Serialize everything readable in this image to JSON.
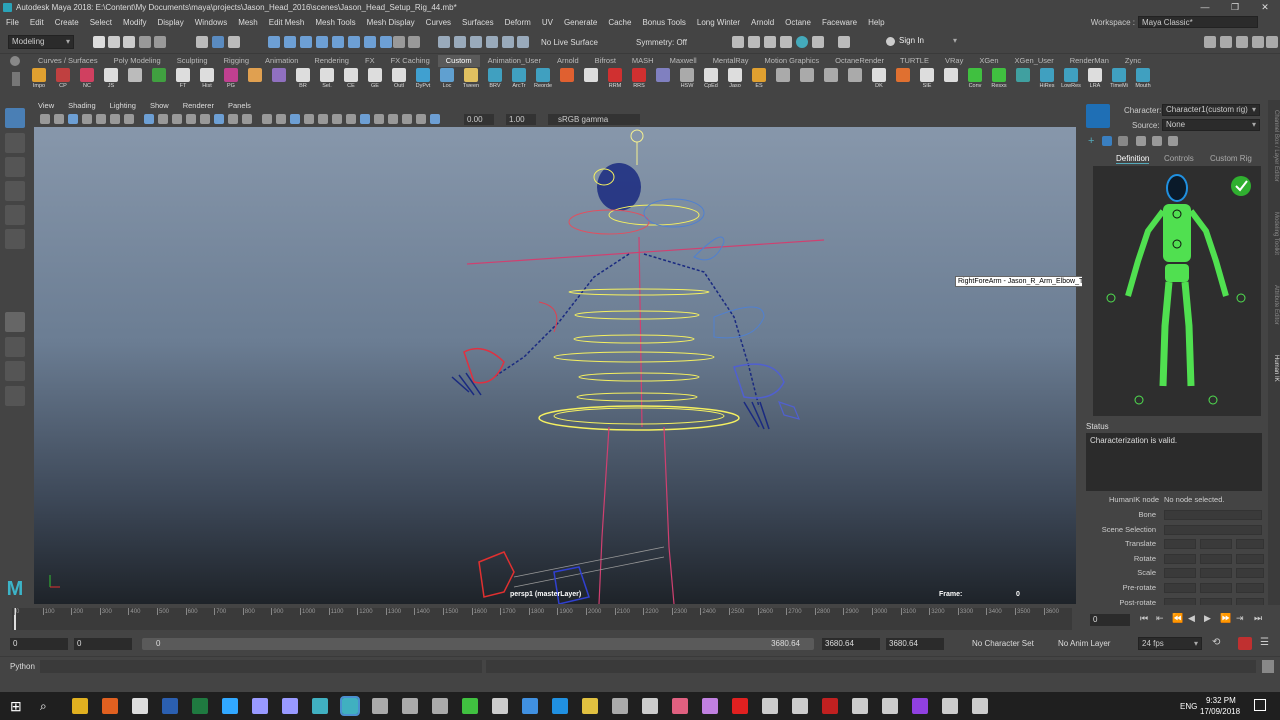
{
  "window": {
    "title": "Autodesk Maya 2018: E:\\Content\\My Documents\\maya\\projects\\Jason_Head_2016\\scenes\\Jason_Head_Setup_Rig_44.mb*"
  },
  "menu": [
    "File",
    "Edit",
    "Create",
    "Select",
    "Modify",
    "Display",
    "Windows",
    "Mesh",
    "Edit Mesh",
    "Mesh Tools",
    "Mesh Display",
    "Curves",
    "Surfaces",
    "Deform",
    "UV",
    "Generate",
    "Cache",
    "Bonus Tools",
    "Long Winter",
    "Arnold",
    "Octane",
    "Faceware",
    "Help"
  ],
  "workspace": {
    "label": "Workspace :",
    "value": "Maya Classic*"
  },
  "statusline": {
    "mode": "Modeling",
    "live_surface": "No Live Surface",
    "symmetry": "Symmetry: Off",
    "sign_in": "Sign In"
  },
  "shelf_tabs": [
    "Curves / Surfaces",
    "Poly Modeling",
    "Sculpting",
    "Rigging",
    "Animation",
    "Rendering",
    "FX",
    "FX Caching",
    "Custom",
    "Animation_User",
    "Arnold",
    "Bifrost",
    "MASH",
    "Maxwell",
    "MentalRay",
    "Motion Graphics",
    "OctaneRender",
    "TURTLE",
    "VRay",
    "XGen",
    "XGen_User",
    "RenderMan",
    "Zync"
  ],
  "shelf_active": "Custom",
  "shelf_items": [
    {
      "label": "Impo",
      "icon": "import-icon",
      "color": "#e0a030"
    },
    {
      "label": "CP",
      "icon": "component-icon",
      "color": "#c04040"
    },
    {
      "label": "NC",
      "icon": "nurbs-circle-icon",
      "color": "#d04060"
    },
    {
      "label": "JS",
      "icon": "joint-icon",
      "color": "#dddddd"
    },
    {
      "label": "",
      "icon": "move-pivot-icon",
      "color": "#bbbbbb"
    },
    {
      "label": "",
      "icon": "grid-icon",
      "color": "#40a040"
    },
    {
      "label": "FT",
      "icon": "freeze-icon",
      "color": "#dddddd"
    },
    {
      "label": "Hist",
      "icon": "history-icon",
      "color": "#dddddd"
    },
    {
      "label": "PG",
      "icon": "paint-icon",
      "color": "#c04090"
    },
    {
      "label": "",
      "icon": "hand-icon",
      "color": "#e0a050"
    },
    {
      "label": "",
      "icon": "paint-weights-icon",
      "color": "#9070c0"
    },
    {
      "label": "BR",
      "icon": "brush-icon",
      "color": "#dddddd"
    },
    {
      "label": "Sel.",
      "icon": "select-icon",
      "color": "#dddddd"
    },
    {
      "label": "CE",
      "icon": "curve-editor-icon",
      "color": "#dddddd"
    },
    {
      "label": "GE",
      "icon": "graph-editor-icon",
      "color": "#dddddd"
    },
    {
      "label": "Outl",
      "icon": "outliner-icon",
      "color": "#dddddd"
    },
    {
      "label": "DyPvt",
      "icon": "pivot-icon",
      "color": "#40a0d0"
    },
    {
      "label": "Loc",
      "icon": "locator-icon",
      "color": "#60a0d0"
    },
    {
      "label": "Tween",
      "icon": "tween-icon",
      "color": "#e0c060"
    },
    {
      "label": "BRV",
      "icon": "brv-icon",
      "color": "#40a0c0"
    },
    {
      "label": "ArcTr",
      "icon": "arc-tracker-icon",
      "color": "#40a0c0"
    },
    {
      "label": "Reorde",
      "icon": "reorder-icon",
      "color": "#40a0c0"
    },
    {
      "label": "",
      "icon": "diamond-icon",
      "color": "#e06030"
    },
    {
      "label": "",
      "icon": "sphere-icon",
      "color": "#dddddd"
    },
    {
      "label": "RRM",
      "icon": "rrm-icon",
      "color": "#d03030"
    },
    {
      "label": "RRS",
      "icon": "rrs-icon",
      "color": "#d03030"
    },
    {
      "label": "",
      "icon": "transfer-icon",
      "color": "#8080c0"
    },
    {
      "label": "HSW",
      "icon": "hsw-icon",
      "color": "#aaaaaa"
    },
    {
      "label": "CpEd",
      "icon": "cp-edit-icon",
      "color": "#dddddd"
    },
    {
      "label": "Jaso",
      "icon": "jason-icon",
      "color": "#dddddd"
    },
    {
      "label": "ES",
      "icon": "es-icon",
      "color": "#e0a030"
    },
    {
      "label": "",
      "icon": "eye-icon",
      "color": "#aaaaaa"
    },
    {
      "label": "",
      "icon": "ring-icon",
      "color": "#aaaaaa"
    },
    {
      "label": "",
      "icon": "cylinder-icon",
      "color": "#aaaaaa"
    },
    {
      "label": "",
      "icon": "cube-icon",
      "color": "#aaaaaa"
    },
    {
      "label": "DK",
      "icon": "dk-icon",
      "color": "#dddddd"
    },
    {
      "label": "",
      "icon": "octane-icon",
      "color": "#e07030"
    },
    {
      "label": "SIE",
      "icon": "sie-icon",
      "color": "#dddddd"
    },
    {
      "label": "",
      "icon": "s-icon",
      "color": "#dddddd"
    },
    {
      "label": "Conv",
      "icon": "convert-icon",
      "color": "#40c040"
    },
    {
      "label": "Resxs",
      "icon": "resxs-icon",
      "color": "#40c040"
    },
    {
      "label": "",
      "icon": "script-icon",
      "color": "#40a0a0"
    },
    {
      "label": "HiRes",
      "icon": "hires-icon",
      "color": "#40a0c0"
    },
    {
      "label": "LowRes",
      "icon": "lowres-icon",
      "color": "#40a0c0"
    },
    {
      "label": "LRA",
      "icon": "lra-icon",
      "color": "#dddddd"
    },
    {
      "label": "TimeMi",
      "icon": "time-icon",
      "color": "#40a0c0"
    },
    {
      "label": "Mouth",
      "icon": "mouth-icon",
      "color": "#40a0c0"
    }
  ],
  "viewport": {
    "menu": [
      "View",
      "Shading",
      "Lighting",
      "Show",
      "Renderer",
      "Panels"
    ],
    "exposure": "0.00",
    "gamma": "1.00",
    "color_space": "sRGB gamma",
    "camera_label": "persp1 (masterLayer)",
    "frame_label": "Frame:",
    "frame_value": "0",
    "tooltip": "RightForeArm - Jason_R_Arm_Elbow_TwistStartJnt"
  },
  "hik": {
    "character_label": "Character:",
    "character_value": "Character1(custom rig)",
    "source_label": "Source:",
    "source_value": "None",
    "tabs": [
      "Definition",
      "Controls",
      "Custom Rig"
    ],
    "active_tab": "Definition",
    "status_title": "Status",
    "status_text": "Characterization is valid.",
    "node_label": "HumanIK node",
    "node_value": "No node selected.",
    "props": [
      "Bone",
      "Scene Selection",
      "Translate",
      "Rotate",
      "Scale",
      "Pre-rotate",
      "Post-rotate"
    ]
  },
  "right_strip": [
    "Channel Box / Layer Editor",
    "Modeling Toolkit",
    "Attribute Editor",
    "Human IK"
  ],
  "timeline": {
    "ticks": [
      "0",
      "100",
      "200",
      "300",
      "400",
      "500",
      "600",
      "700",
      "800",
      "900",
      "1000",
      "1100",
      "1200",
      "1300",
      "1400",
      "1500",
      "1600",
      "1700",
      "1800",
      "1900",
      "2000",
      "2100",
      "2200",
      "2300",
      "2400",
      "2500",
      "2600",
      "2700",
      "2800",
      "2900",
      "3000",
      "3100",
      "3200",
      "3300",
      "3400",
      "3500",
      "3600"
    ],
    "current_frame": "0"
  },
  "range": {
    "start": "0",
    "start2": "0",
    "slider_start": "0",
    "slider_end": "3680.64",
    "end": "3680.64",
    "end2": "3680.64",
    "character_set": "No Character Set",
    "anim_layer": "No Anim Layer",
    "fps": "24 fps"
  },
  "cmdline": {
    "label": "Python"
  },
  "taskbar": {
    "time": "9:32 PM",
    "date": "17/09/2018",
    "lang": "ENG",
    "apps": [
      {
        "icon": "chrome-icon",
        "color": "#e0b020"
      },
      {
        "icon": "firefox-icon",
        "color": "#e06020"
      },
      {
        "icon": "tool-icon",
        "color": "#dddddd"
      },
      {
        "icon": "word-icon",
        "color": "#2b5fb0"
      },
      {
        "icon": "excel-icon",
        "color": "#1f7a40"
      },
      {
        "icon": "photoshop-icon",
        "color": "#31a8ff"
      },
      {
        "icon": "premiere-icon",
        "color": "#9999ff"
      },
      {
        "icon": "aftereffects-icon",
        "color": "#9999ff"
      },
      {
        "icon": "maya-icon",
        "color": "#40b0c0"
      },
      {
        "icon": "maya-active-icon",
        "color": "#40b0c0"
      },
      {
        "icon": "tool2-icon",
        "color": "#aaaaaa"
      },
      {
        "icon": "tool3-icon",
        "color": "#aaaaaa"
      },
      {
        "icon": "rg-icon",
        "color": "#aaaaaa"
      },
      {
        "icon": "green-icon",
        "color": "#40c040"
      },
      {
        "icon": "tool4-icon",
        "color": "#cccccc"
      },
      {
        "icon": "tool5-icon",
        "color": "#4090e0"
      },
      {
        "icon": "skype-icon",
        "color": "#2090e0"
      },
      {
        "icon": "folder-icon",
        "color": "#e0c040"
      },
      {
        "icon": "tool6-icon",
        "color": "#aaaaaa"
      },
      {
        "icon": "calc-icon",
        "color": "#cccccc"
      },
      {
        "icon": "tool7-icon",
        "color": "#e06080"
      },
      {
        "icon": "tool8-icon",
        "color": "#c080e0"
      },
      {
        "icon": "tool9-icon",
        "color": "#e02020"
      },
      {
        "icon": "tool10-icon",
        "color": "#cccccc"
      },
      {
        "icon": "tool11-icon",
        "color": "#cccccc"
      },
      {
        "icon": "filezilla-icon",
        "color": "#c02020"
      },
      {
        "icon": "tool12-icon",
        "color": "#cccccc"
      },
      {
        "icon": "tool13-icon",
        "color": "#cccccc"
      },
      {
        "icon": "twitch-icon",
        "color": "#9040e0"
      },
      {
        "icon": "tool14-icon",
        "color": "#cccccc"
      },
      {
        "icon": "tool15-icon",
        "color": "#cccccc"
      }
    ]
  }
}
